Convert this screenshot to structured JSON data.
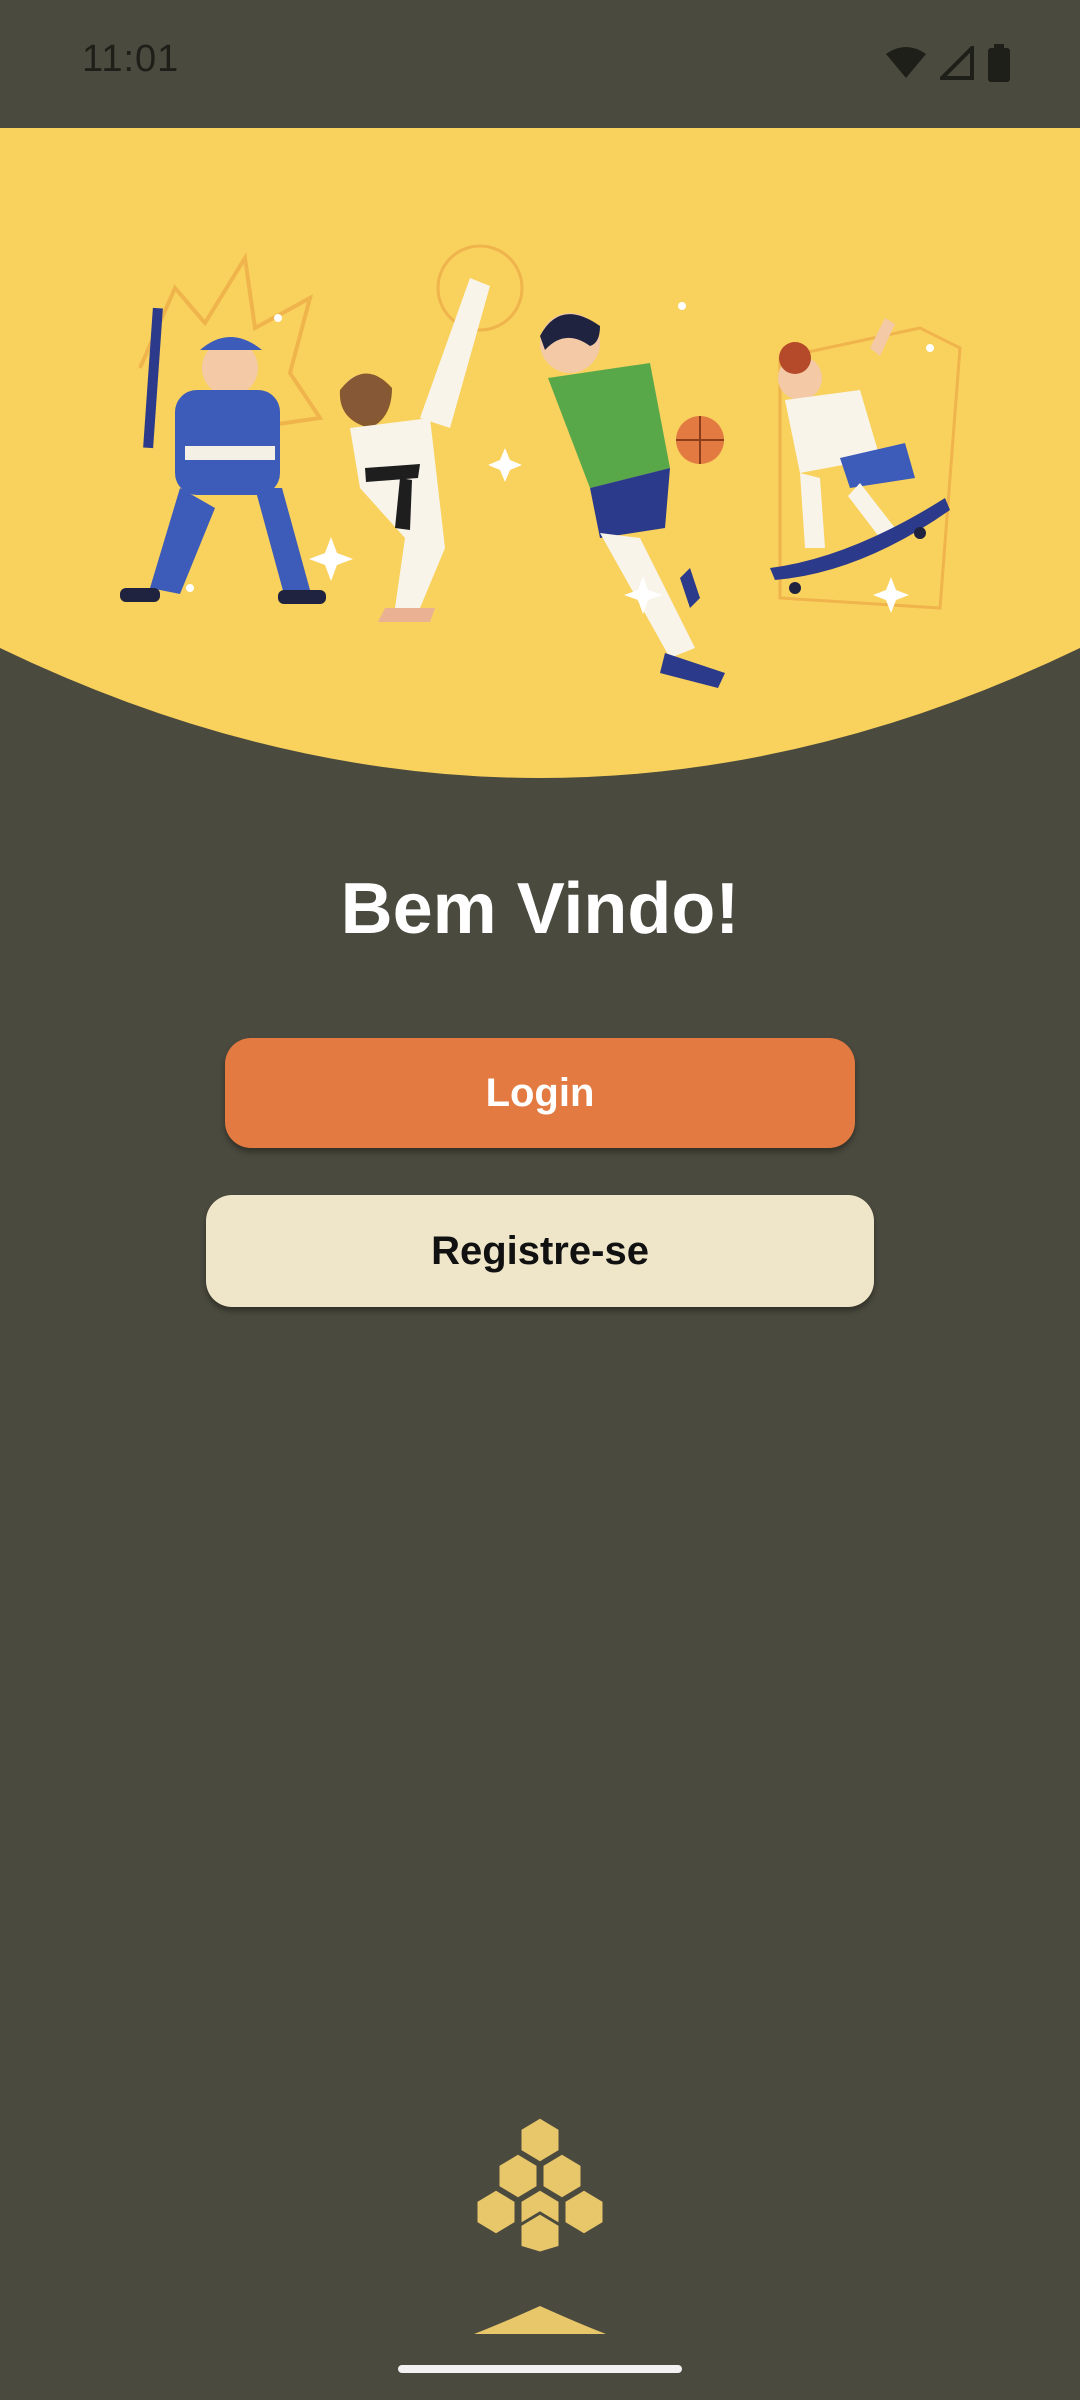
{
  "status_bar": {
    "time": "11:01",
    "icons": [
      "wifi-icon",
      "cellular-signal-icon",
      "battery-icon"
    ]
  },
  "hero": {
    "illustration": "sports-people-illustration",
    "background_color": "#f9d15d"
  },
  "main": {
    "title": "Bem Vindo!",
    "login_label": "Login",
    "register_label": "Registre-se"
  },
  "footer": {
    "logo": "honeycomb-logo-icon",
    "handle": "swipe-up-handle-icon"
  },
  "colors": {
    "background": "#4a4a3e",
    "accent": "#e27a41",
    "secondary_button": "#efe6c9",
    "hero_yellow": "#f9d15d",
    "logo_yellow": "#e8c66a"
  }
}
